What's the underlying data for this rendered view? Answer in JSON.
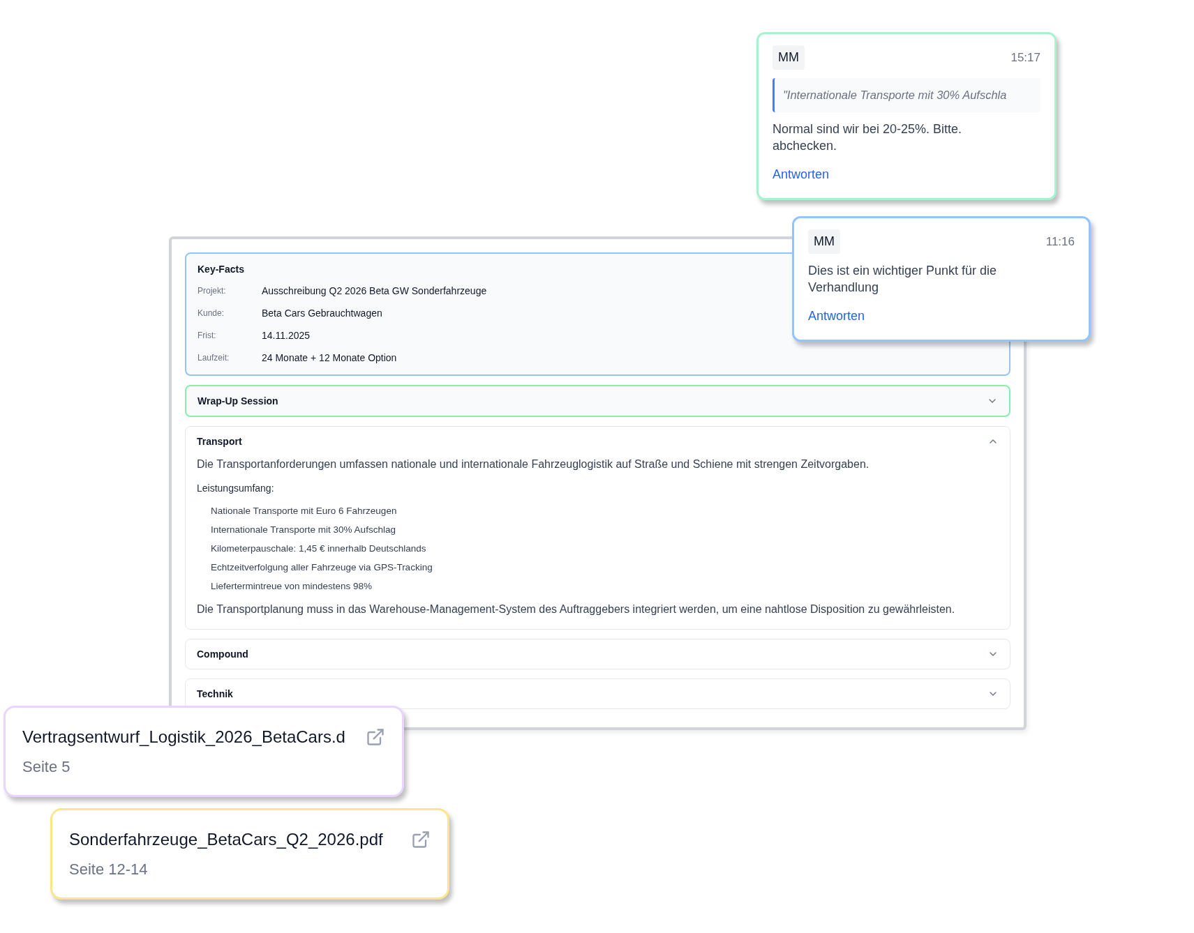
{
  "key_facts": {
    "title": "Key-Facts",
    "rows": [
      {
        "label": "Projekt:",
        "value": "Ausschreibung Q2 2026 Beta GW Sonderfahrzeuge"
      },
      {
        "label": "Kunde:",
        "value": "Beta Cars Gebrauchtwagen"
      },
      {
        "label": "Frist:",
        "value": "14.11.2025"
      },
      {
        "label": "Laufzeit:",
        "value": "24 Monate + 12 Monate Option"
      }
    ]
  },
  "sections": [
    {
      "title": "Wrap-Up Session",
      "expanded": false,
      "highlighted": true
    },
    {
      "title": "Transport",
      "expanded": true,
      "highlighted": false,
      "intro": "Die Transportanforderungen umfassen nationale und internationale Fahrzeuglogistik auf Straße und Schiene mit strengen Zeitvorgaben.",
      "list_title": "Leistungsumfang:",
      "items": [
        "Nationale Transporte mit Euro 6 Fahrzeugen",
        "Internationale Transporte mit 30% Aufschlag",
        "Kilometerpauschale: 1,45 € innerhalb Deutschlands",
        "Echtzeitverfolgung aller Fahrzeuge via GPS-Tracking",
        "Liefertermintreue von mindestens 98%"
      ],
      "outro": "Die Transportplanung muss in das Warehouse-Management-System des Auftraggebers integriert werden, um eine nahtlose Disposition zu gewährleisten."
    },
    {
      "title": "Compound",
      "expanded": false,
      "highlighted": false
    },
    {
      "title": "Technik",
      "expanded": false,
      "highlighted": false
    }
  ],
  "comments": [
    {
      "initials": "MM",
      "time": "15:17",
      "quote": "\"Internationale Transporte mit 30% Aufschla",
      "text": "Normal sind wir bei 20-25%. Bitte. abchecken.",
      "reply": "Antworten",
      "color": "#a7f3d0"
    },
    {
      "initials": "MM",
      "time": "11:16",
      "text": "Dies ist ein wichtiger Punkt für die Verhandlung",
      "reply": "Antworten",
      "color": "#93c5fd"
    }
  ],
  "documents": [
    {
      "name": "Vertragsentwurf_Logistik_2026_BetaCars.d",
      "page": "Seite 5",
      "color": "#e9d5ff"
    },
    {
      "name": "Sonderfahrzeuge_BetaCars_Q2_2026.pdf",
      "page": "Seite 12-14",
      "color": "#fde68a"
    }
  ]
}
